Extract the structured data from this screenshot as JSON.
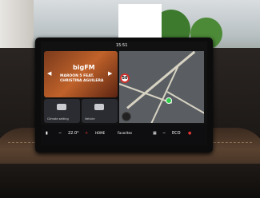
{
  "photo": {
    "description_colors": {
      "leather": "#5a4230",
      "screen_bg": "#111111",
      "map_bg": "#5a5e63",
      "media_accent": "#c0622a",
      "alert_red": "#e23434"
    }
  },
  "screen": {
    "status": {
      "time": "15:51"
    },
    "media": {
      "station_logo": "bigFM",
      "track_artist": "MAROON 5 FEAT.",
      "track_title": "CHRISTINA AGUILERA"
    },
    "tiles": [
      {
        "label": "Climate setting",
        "icon": "car-icon"
      },
      {
        "label": "Vehicle",
        "icon": "seat-icon"
      }
    ],
    "map": {
      "speed_limit": "50"
    },
    "bottom_bar": {
      "temperature": "22.0°",
      "minus": "−",
      "plus": "+",
      "home_label": "HOME",
      "favorites_label": "Favorites",
      "eco_label": "ECO",
      "fan_minus": "−"
    }
  }
}
